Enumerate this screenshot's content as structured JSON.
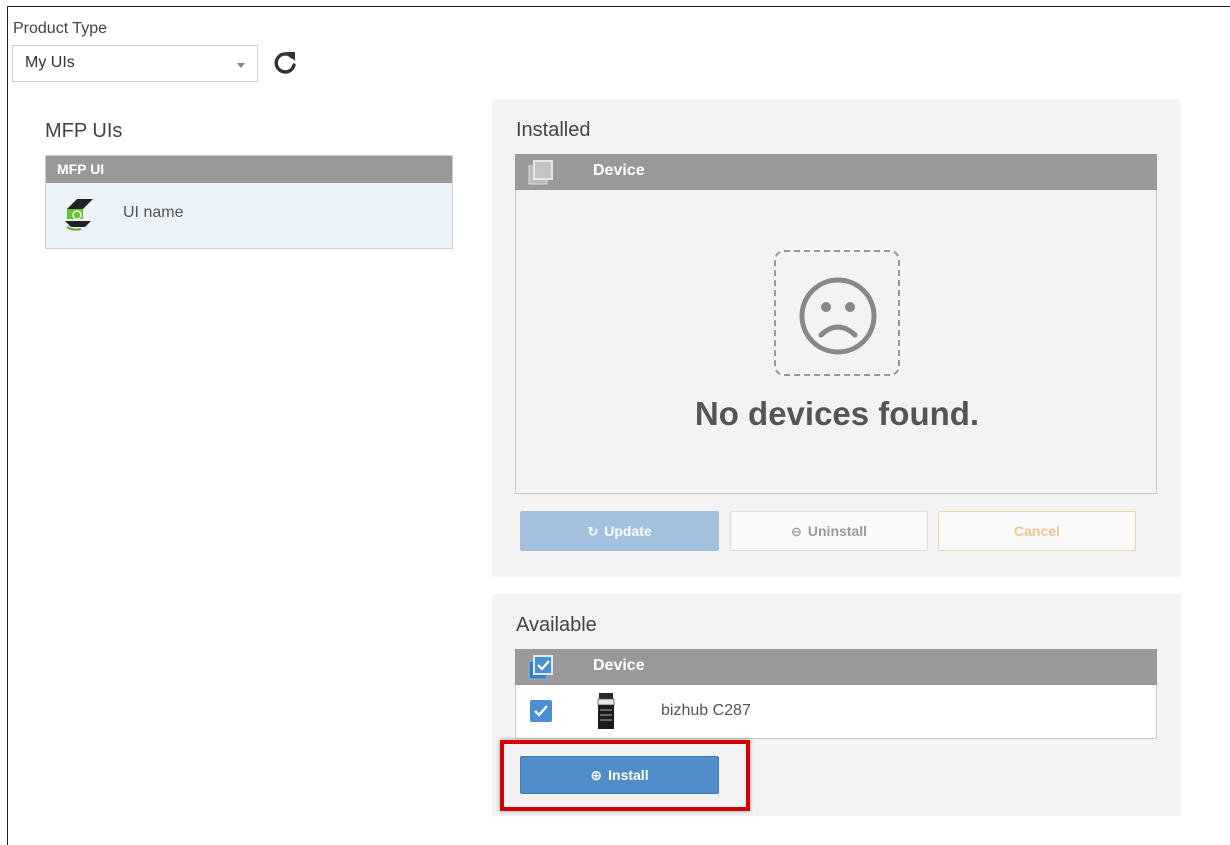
{
  "product_type": {
    "label": "Product Type",
    "selected": "My UIs"
  },
  "mfp_uis": {
    "title": "MFP UIs",
    "column_header": "MFP UI",
    "rows": [
      {
        "name": "UI name",
        "icon": "ui-logo-icon"
      }
    ]
  },
  "installed": {
    "title": "Installed",
    "column_header": "Device",
    "empty_message": "No devices found.",
    "buttons": {
      "update": "Update",
      "uninstall": "Uninstall",
      "cancel": "Cancel"
    }
  },
  "available": {
    "title": "Available",
    "column_header": "Device",
    "devices": [
      {
        "name": "bizhub C287",
        "checked": true,
        "icon": "printer-icon"
      }
    ],
    "install_label": "Install"
  },
  "colors": {
    "header_gray": "#999999",
    "primary_blue": "#4f8ec9",
    "disabled_blue": "#a3c1df",
    "cancel_orange": "#f0c590",
    "highlight_red": "#d40000"
  }
}
